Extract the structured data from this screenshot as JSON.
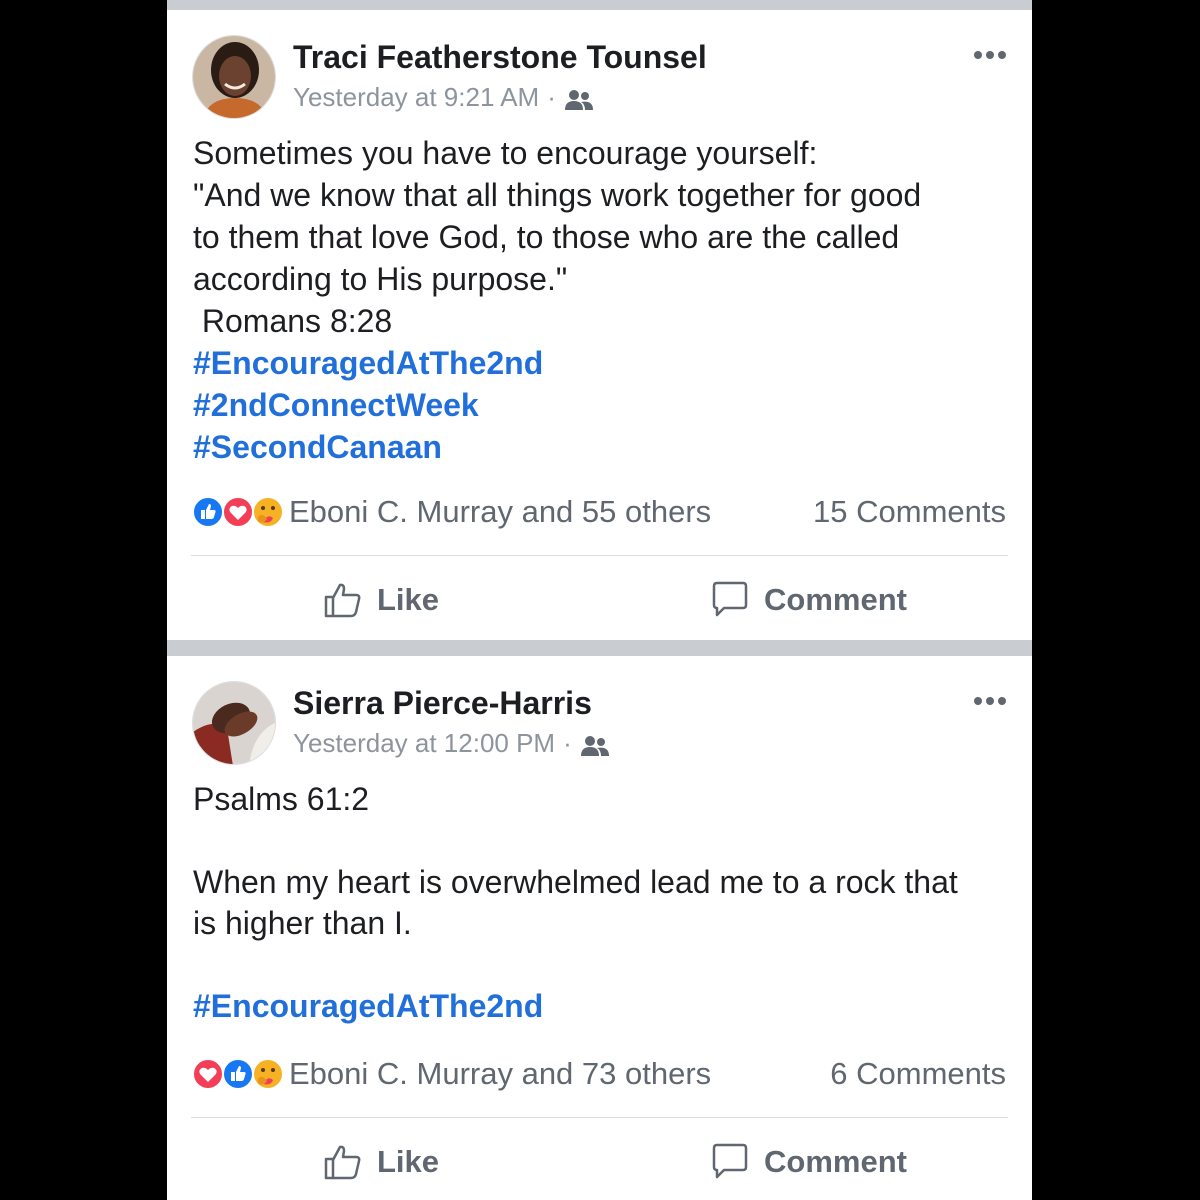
{
  "posts": [
    {
      "author": "Traci Featherstone Tounsel",
      "timestamp": "Yesterday at 9:21 AM",
      "separator": "·",
      "audience_icon": "friends-icon",
      "body_lines": [
        "Sometimes you have to encourage yourself:",
        "\"And we know that all things work together for good",
        "to them that love God, to those who are the called",
        "according to His purpose.\"",
        " Romans 8:28"
      ],
      "hashtags": [
        "#EncouragedAtThe2nd",
        "#2ndConnectWeek",
        "#SecondCanaan"
      ],
      "reactions": [
        "like",
        "love",
        "care"
      ],
      "reaction_summary": "Eboni C. Murray and 55 others",
      "comment_count": "15 Comments",
      "like_label": "Like",
      "comment_label": "Comment"
    },
    {
      "author": "Sierra Pierce-Harris",
      "timestamp": "Yesterday at 12:00 PM",
      "separator": "·",
      "audience_icon": "friends-icon",
      "body_lines": [
        "Psalms 61:2",
        "",
        "When my heart is overwhelmed lead me to a rock that",
        "is higher than I."
      ],
      "hashtags": [
        "#EncouragedAtThe2nd"
      ],
      "reactions": [
        "love",
        "like",
        "care"
      ],
      "reaction_summary": "Eboni C. Murray and 73 others",
      "comment_count": "6 Comments",
      "like_label": "Like",
      "comment_label": "Comment"
    }
  ],
  "colors": {
    "hashtag": "#216fdb",
    "like_blue": "#1877f2",
    "love_red": "#f33e58",
    "care_yellow": "#f7b125",
    "meta_gray": "#8d949e",
    "feed_gap": "#c9ccd1"
  }
}
